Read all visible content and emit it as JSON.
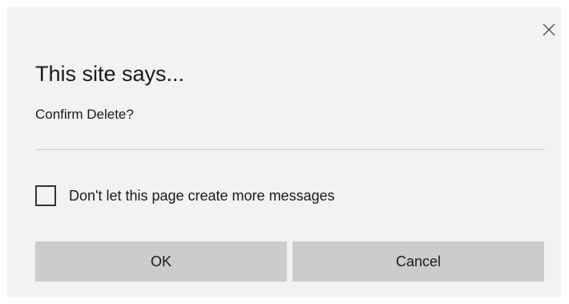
{
  "dialog": {
    "title": "This site says...",
    "message": "Confirm Delete?",
    "close_icon": "close-icon",
    "checkbox_label": "Don't let this page create more messages",
    "checkbox_checked": false,
    "buttons": {
      "ok": "OK",
      "cancel": "Cancel"
    }
  },
  "colors": {
    "dialog_background": "#f2f2f2",
    "button_background": "#cccccc",
    "text": "#1a1a1a"
  }
}
